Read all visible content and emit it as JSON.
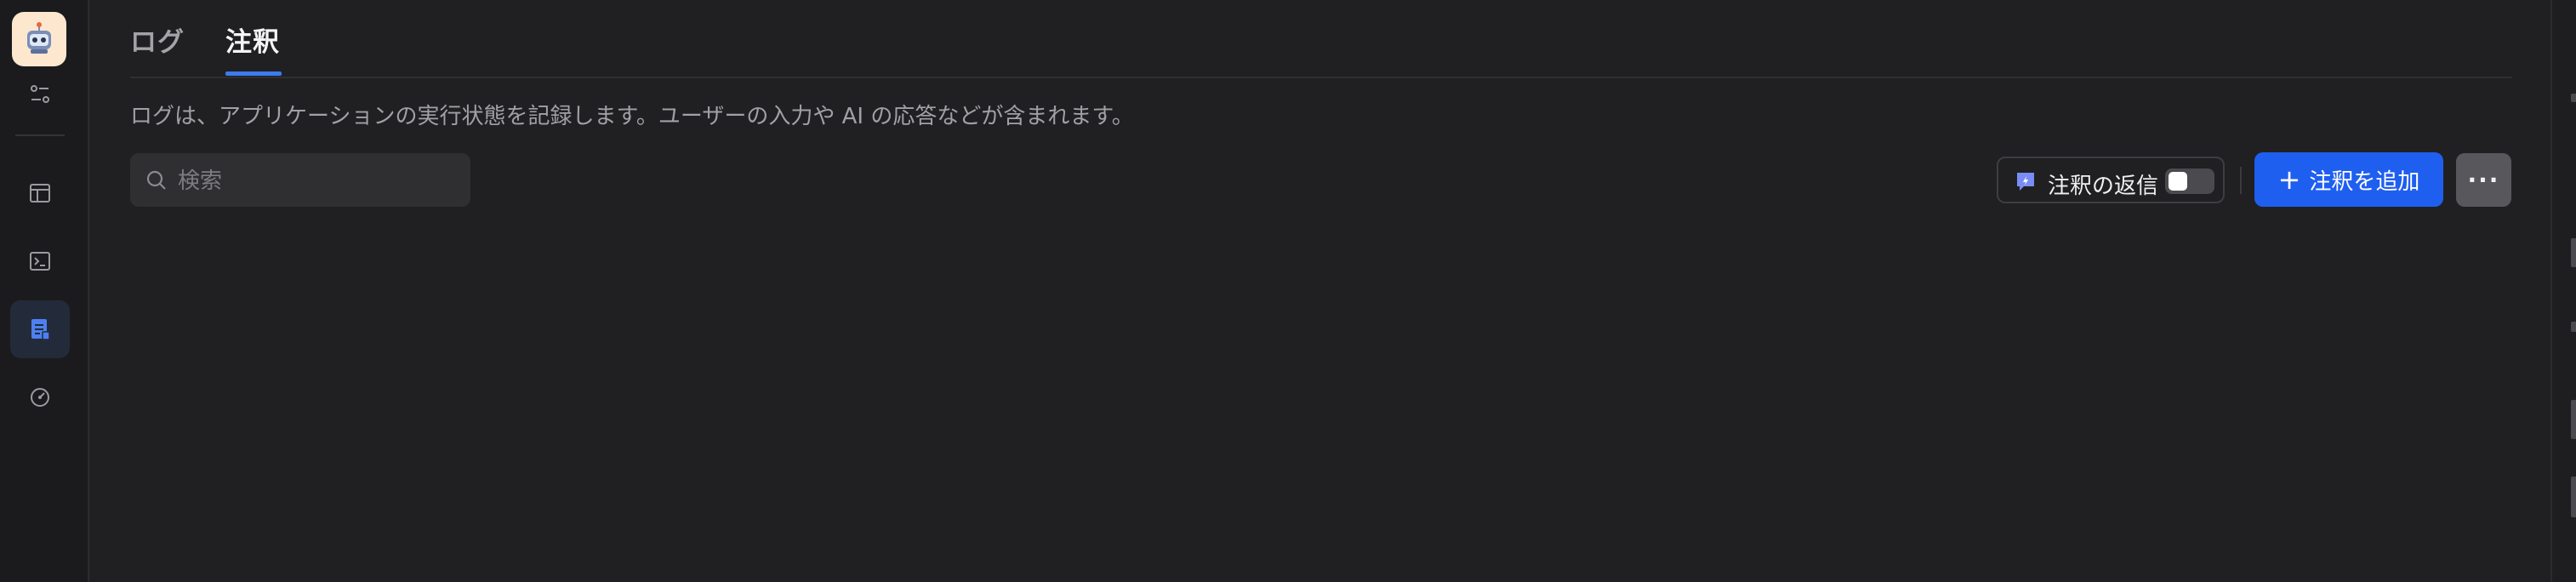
{
  "app": {
    "icon": "robot-avatar-icon"
  },
  "sidebar": {
    "items": [
      {
        "name": "settings-sliders-icon"
      },
      {
        "name": "browser-window-icon"
      },
      {
        "name": "terminal-icon"
      },
      {
        "name": "document-icon",
        "active": true
      },
      {
        "name": "gauge-icon"
      }
    ]
  },
  "tabs": [
    {
      "label": "ログ",
      "active": false
    },
    {
      "label": "注釈",
      "active": true
    }
  ],
  "description": "ログは、アプリケーションの実行状態を記録します。ユーザーの入力や AI の応答などが含まれます。",
  "search": {
    "placeholder": "検索",
    "value": ""
  },
  "annotation_reply": {
    "label": "注釈の返信",
    "enabled": false
  },
  "add_annotation": {
    "label": "注釈を追加"
  },
  "more": {
    "label": "···"
  },
  "colors": {
    "accent": "#1f5ff0",
    "tab_underline": "#3b7bf0",
    "background": "#202022"
  }
}
